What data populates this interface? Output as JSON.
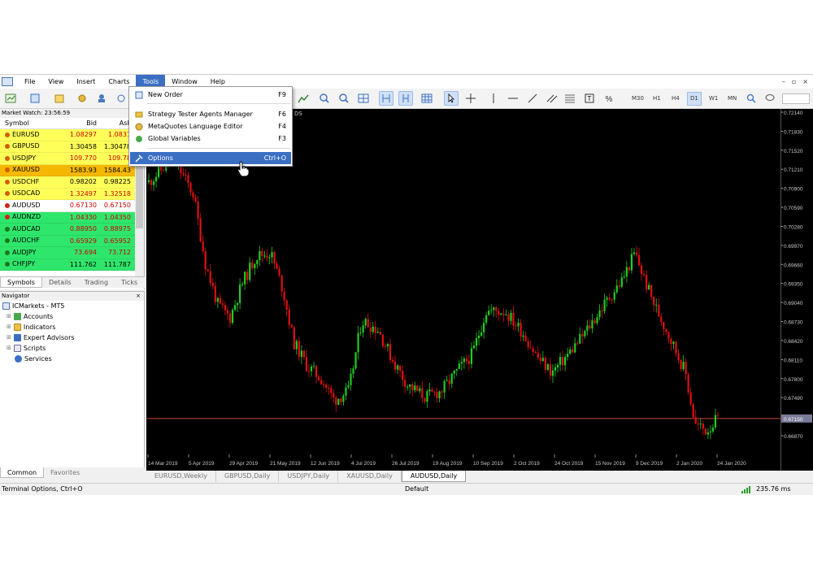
{
  "menubar": {
    "items": [
      "File",
      "View",
      "Insert",
      "Charts",
      "Tools",
      "Window",
      "Help"
    ],
    "active": "Tools"
  },
  "toolbar": {
    "timeframes": [
      "M30",
      "H1",
      "H4",
      "D1",
      "W1",
      "MN"
    ],
    "selected_timeframe": "D1"
  },
  "market_watch": {
    "title": "Market Watch: 23:56:59",
    "columns": [
      "Symbol",
      "Bid",
      "Ask"
    ],
    "rows": [
      {
        "symbol": "EURUSD",
        "bid": "1.08297",
        "ask": "1.0831",
        "bg": "#ffff5a",
        "color": "#cc0000",
        "dot": "#d06000"
      },
      {
        "symbol": "GBPUSD",
        "bid": "1.30458",
        "ask": "1.30478",
        "bg": "#ffff5a",
        "color": "#000000",
        "dot": "#d06000"
      },
      {
        "symbol": "USDJPY",
        "bid": "109.770",
        "ask": "109.78",
        "bg": "#ffff5a",
        "color": "#cc0000",
        "dot": "#d06000"
      },
      {
        "symbol": "XAUUSD",
        "bid": "1583.93",
        "ask": "1584.43",
        "bg": "#f5b800",
        "color": "#000000",
        "dot": "#d06000"
      },
      {
        "symbol": "USDCHF",
        "bid": "0.98202",
        "ask": "0.98225",
        "bg": "#ffff5a",
        "color": "#000000",
        "dot": "#d06000"
      },
      {
        "symbol": "USDCAD",
        "bid": "1.32497",
        "ask": "1.32518",
        "bg": "#ffff5a",
        "color": "#cc0000",
        "dot": "#d06000"
      },
      {
        "symbol": "AUDUSD",
        "bid": "0.67130",
        "ask": "0.67150",
        "bg": "#ffffff",
        "color": "#cc0000",
        "dot": "#d02020"
      },
      {
        "symbol": "AUDNZD",
        "bid": "1.04330",
        "ask": "1.04350",
        "bg": "#2ee66b",
        "color": "#cc0000",
        "dot": "#d02020"
      },
      {
        "symbol": "AUDCAD",
        "bid": "0.88950",
        "ask": "0.88975",
        "bg": "#2ee66b",
        "color": "#cc0000",
        "dot": "#1a7a1a"
      },
      {
        "symbol": "AUDCHF",
        "bid": "0.65929",
        "ask": "0.65952",
        "bg": "#2ee66b",
        "color": "#cc0000",
        "dot": "#1a7a1a"
      },
      {
        "symbol": "AUDJPY",
        "bid": "73.694",
        "ask": "73.712",
        "bg": "#2ee66b",
        "color": "#cc0000",
        "dot": "#1a7a1a"
      },
      {
        "symbol": "CHFJPY",
        "bid": "111.762",
        "ask": "111.787",
        "bg": "#2ee66b",
        "color": "#000000",
        "dot": "#1a7a1a"
      }
    ],
    "tabs": [
      "Symbols",
      "Details",
      "Trading",
      "Ticks"
    ],
    "active_tab": "Symbols"
  },
  "navigator": {
    "title": "Navigator",
    "close": "×",
    "root": "ICMarkets - MT5",
    "items": [
      "Accounts",
      "Indicators",
      "Expert Advisors",
      "Scripts",
      "Services"
    ],
    "tabs": [
      "Common",
      "Favorites"
    ],
    "active_tab": "Common"
  },
  "tools_menu": {
    "items": [
      {
        "label": "New Order",
        "shortcut": "F9",
        "icon": "new-order-icon"
      },
      {
        "label": "Strategy Tester Agents Manager",
        "shortcut": "F6",
        "icon": "agents-icon"
      },
      {
        "label": "MetaQuotes Language Editor",
        "shortcut": "F4",
        "icon": "editor-icon"
      },
      {
        "label": "Global Variables",
        "shortcut": "F3",
        "icon": "global-vars-icon"
      },
      {
        "label": "Options",
        "shortcut": "Ctrl+O",
        "icon": "options-icon"
      }
    ],
    "highlighted": "Options"
  },
  "chart": {
    "symbol_fragment": "DS",
    "price_labels": [
      "0.72140",
      "0.71830",
      "0.71520",
      "0.71210",
      "0.70900",
      "0.70590",
      "0.70280",
      "0.69970",
      "0.69660",
      "0.69350",
      "0.69040",
      "0.68730",
      "0.68420",
      "0.68110",
      "0.67800",
      "0.67490",
      "0.66870"
    ],
    "current_price": "0.67150",
    "date_labels": [
      "14 Mar 2019",
      "5 Apr 2019",
      "29 Apr 2019",
      "21 May 2019",
      "12 Jun 2019",
      "4 Jul 2019",
      "26 Jul 2019",
      "19 Aug 2019",
      "10 Sep 2019",
      "2 Oct 2019",
      "24 Oct 2019",
      "15 Nov 2019",
      "9 Dec 2019",
      "2 Jan 2020",
      "24 Jan 2020"
    ],
    "colors": {
      "bull": "#22cc22",
      "bear": "#dd1111",
      "price_line": "#d04040",
      "bg": "#000000"
    }
  },
  "chart_tabs": {
    "items": [
      "EURUSD,Weekly",
      "GBPUSD,Daily",
      "USDJPY,Daily",
      "XAUUSD,Daily",
      "AUDUSD,Daily"
    ],
    "active": "AUDUSD,Daily"
  },
  "status": {
    "left": "Terminal Options, Ctrl+O",
    "middle": "Default",
    "ping": "235.76 ms"
  }
}
